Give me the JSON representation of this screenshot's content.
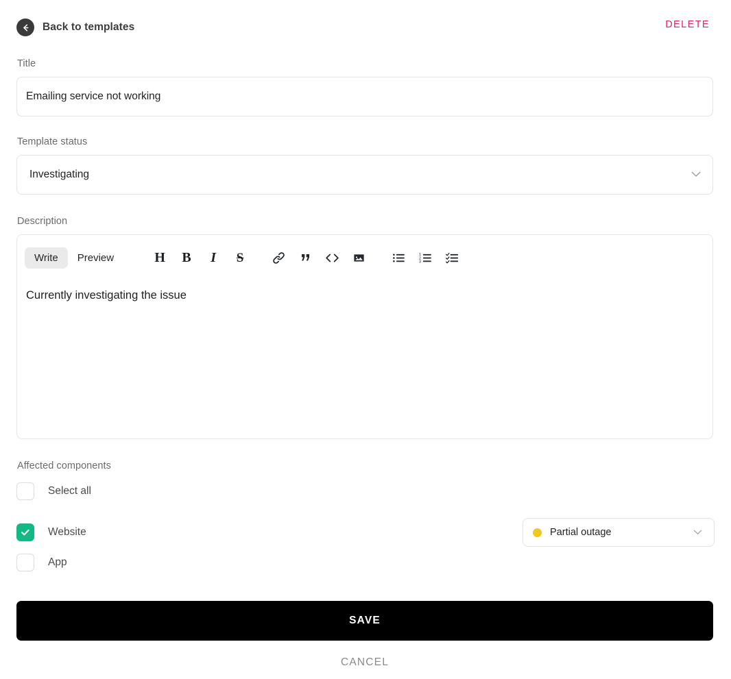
{
  "header": {
    "back_label": "Back to templates",
    "back_icon": "arrow-left-circle-icon",
    "delete_label": "DELETE",
    "delete_color": "#e0245e"
  },
  "title_field": {
    "label": "Title",
    "value": "Emailing service not working",
    "placeholder": "Title"
  },
  "status_field": {
    "label": "Template status",
    "value": "Investigating",
    "chevron_icon": "chevron-down-icon"
  },
  "description": {
    "label": "Description",
    "tabs": [
      {
        "label": "Write",
        "active": true
      },
      {
        "label": "Preview",
        "active": false
      }
    ],
    "format_tools": [
      {
        "name": "heading-icon",
        "glyph": "H",
        "style": "plain"
      },
      {
        "name": "bold-icon",
        "glyph": "B",
        "style": "plain"
      },
      {
        "name": "italic-icon",
        "glyph": "I",
        "style": "italic"
      },
      {
        "name": "strikethrough-icon",
        "glyph": "S",
        "style": "strike"
      }
    ],
    "insert_tools": [
      {
        "name": "link-icon"
      },
      {
        "name": "quote-icon"
      },
      {
        "name": "code-icon"
      },
      {
        "name": "image-icon"
      }
    ],
    "list_tools": [
      {
        "name": "unordered-list-icon"
      },
      {
        "name": "ordered-list-icon"
      },
      {
        "name": "task-list-icon"
      }
    ],
    "body_text": "Currently investigating the issue"
  },
  "components": {
    "label": "Affected components",
    "select_all": {
      "label": "Select all",
      "checked": false
    },
    "items": [
      {
        "label": "Website",
        "checked": true,
        "status": "Partial outage",
        "status_color": "#f2c81e"
      },
      {
        "label": "App",
        "checked": false
      }
    ],
    "checked_color": "#12b886"
  },
  "actions": {
    "save_label": "SAVE",
    "cancel_label": "CANCEL"
  }
}
